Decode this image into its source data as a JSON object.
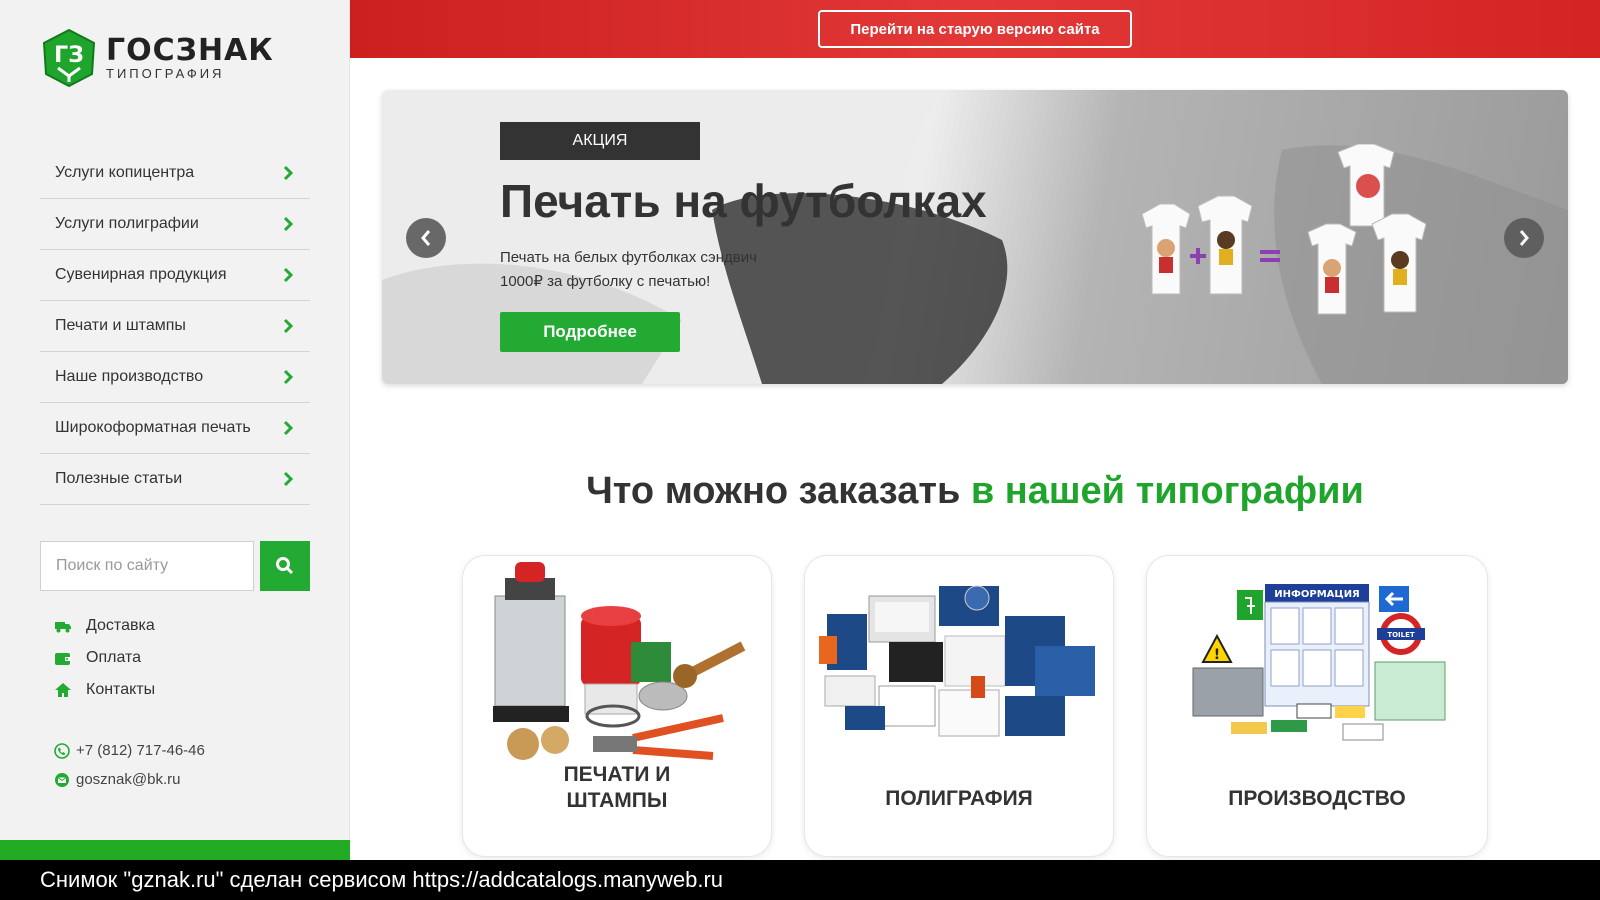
{
  "logo": {
    "title": "ГОСЗНАК",
    "subtitle": "ТИПОГРАФИЯ"
  },
  "sidebar": {
    "menu": [
      {
        "label": "Услуги копицентра"
      },
      {
        "label": "Услуги полиграфии"
      },
      {
        "label": "Сувенирная продукция"
      },
      {
        "label": "Печати и штампы"
      },
      {
        "label": "Наше производство"
      },
      {
        "label": "Широкоформатная печать"
      },
      {
        "label": "Полезные статьи"
      }
    ],
    "search": {
      "placeholder": "Поиск по сайту"
    },
    "links": [
      {
        "label": "Доставка",
        "icon": "truck-icon"
      },
      {
        "label": "Оплата",
        "icon": "wallet-icon"
      },
      {
        "label": "Контакты",
        "icon": "home-icon"
      }
    ],
    "contacts": {
      "phone": "+7 (812) 717-46-46",
      "email": "gosznak@bk.ru"
    }
  },
  "topbar": {
    "old_site_label": "Перейти на старую версию сайта"
  },
  "banner": {
    "badge": "АКЦИЯ",
    "title": "Печать на футболках",
    "desc_line1": "Печать на белых футболках сэндвич",
    "desc_line2": "1000₽ за футболку с печатью!",
    "button": "Подробнее"
  },
  "section": {
    "title_plain": "Что можно заказать ",
    "title_accent": "в нашей типографии"
  },
  "cards": [
    {
      "line1": "ПЕЧАТИ И",
      "line2": "ШТАМПЫ"
    },
    {
      "line1": "ПОЛИГРАФИЯ"
    },
    {
      "line1": "ПРОИЗВОДСТВО"
    }
  ],
  "card_image_text": {
    "info_sign": "ИНФОРМАЦИЯ",
    "toilet_sign": "TOILET"
  },
  "watermark": "Снимок \"gznak.ru\" сделан сервисом https://addcatalogs.manyweb.ru",
  "colors": {
    "brand_green": "#22aa33",
    "topbar_red": "#d42424",
    "dark": "#333333"
  }
}
